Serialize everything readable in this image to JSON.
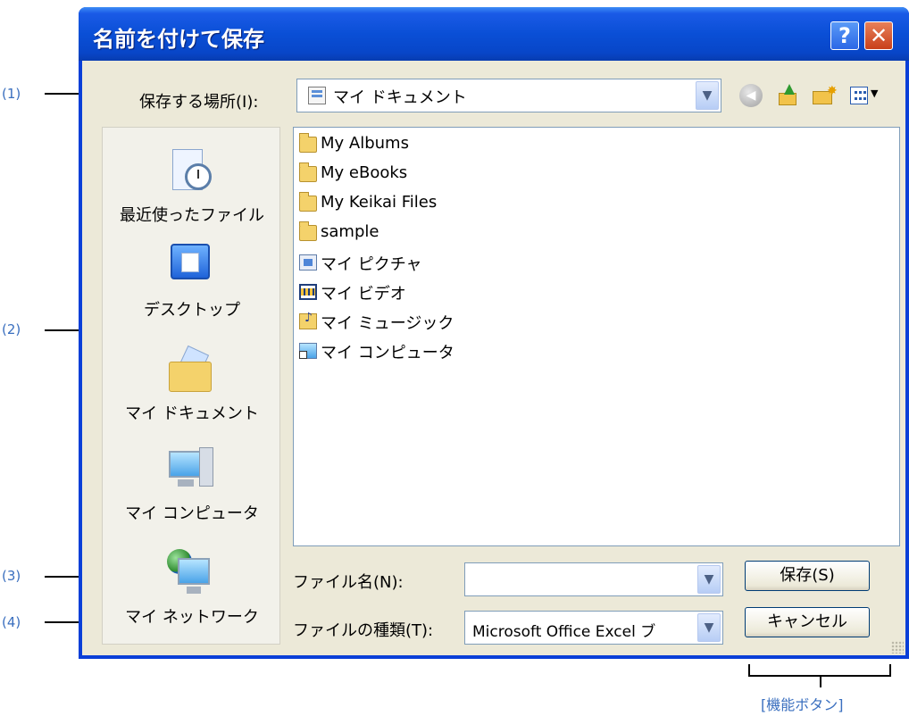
{
  "dialog": {
    "title": "名前を付けて保存",
    "help_label": "?",
    "close_label": "✕"
  },
  "save_in": {
    "label": "保存する場所(I):",
    "value": "マイ ドキュメント"
  },
  "places": [
    {
      "label": "最近使ったファイル",
      "icon": "recent-documents-icon"
    },
    {
      "label": "デスクトップ",
      "icon": "desktop-icon"
    },
    {
      "label": "マイ ドキュメント",
      "icon": "my-documents-icon"
    },
    {
      "label": "マイ コンピュータ",
      "icon": "my-computer-icon"
    },
    {
      "label": "マイ ネットワーク",
      "icon": "my-network-icon"
    }
  ],
  "files": [
    {
      "name": "My Albums",
      "icon": "folder-icon"
    },
    {
      "name": "My eBooks",
      "icon": "folder-icon"
    },
    {
      "name": "My Keikai Files",
      "icon": "folder-icon"
    },
    {
      "name": "sample",
      "icon": "folder-icon"
    },
    {
      "name": "マイ ピクチャ",
      "icon": "pictures-folder-icon"
    },
    {
      "name": "マイ ビデオ",
      "icon": "video-folder-icon"
    },
    {
      "name": "マイ ミュージック",
      "icon": "music-folder-icon"
    },
    {
      "name": "マイ コンピュータ",
      "icon": "computer-shortcut-icon"
    }
  ],
  "file_name": {
    "label": "ファイル名(N):",
    "value": ""
  },
  "file_type": {
    "label": "ファイルの種類(T):",
    "value": "Microsoft Office Excel ブ"
  },
  "buttons": {
    "save": "保存(S)",
    "cancel": "キャンセル"
  },
  "annotations": {
    "a1": "(1)",
    "a2": "(2)",
    "a3": "(3)",
    "a4": "(4)",
    "function_buttons": "[機能ボタン]"
  }
}
